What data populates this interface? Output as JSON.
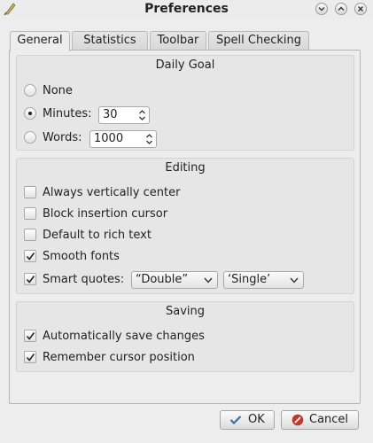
{
  "window": {
    "title": "Preferences",
    "app_icon": "quill-pen-icon",
    "controls": [
      "minimize-icon",
      "maximize-icon",
      "close-icon"
    ]
  },
  "tabs": [
    {
      "label": "General",
      "active": true
    },
    {
      "label": "Statistics",
      "active": false
    },
    {
      "label": "Toolbar",
      "active": false
    },
    {
      "label": "Spell Checking",
      "active": false
    }
  ],
  "daily_goal": {
    "title": "Daily Goal",
    "none_label": "None",
    "minutes_label": "Minutes:",
    "minutes_value": "30",
    "words_label": "Words:",
    "words_value": "1000",
    "selected": "minutes"
  },
  "editing": {
    "title": "Editing",
    "always_center": {
      "label": "Always vertically center",
      "checked": false
    },
    "block_cursor": {
      "label": "Block insertion cursor",
      "checked": false
    },
    "rich_text": {
      "label": "Default to rich text",
      "checked": false
    },
    "smooth_fonts": {
      "label": "Smooth fonts",
      "checked": true
    },
    "smart_quotes": {
      "label": "Smart quotes:",
      "checked": true,
      "double": "“Double”",
      "single": "‘Single’"
    }
  },
  "saving": {
    "title": "Saving",
    "auto_save": {
      "label": "Automatically save changes",
      "checked": true
    },
    "remember_cursor": {
      "label": "Remember cursor position",
      "checked": true
    }
  },
  "buttons": {
    "ok": "OK",
    "cancel": "Cancel"
  },
  "colors": {
    "ok_icon": "#3a6ea5",
    "cancel_icon": "#c0392b"
  }
}
